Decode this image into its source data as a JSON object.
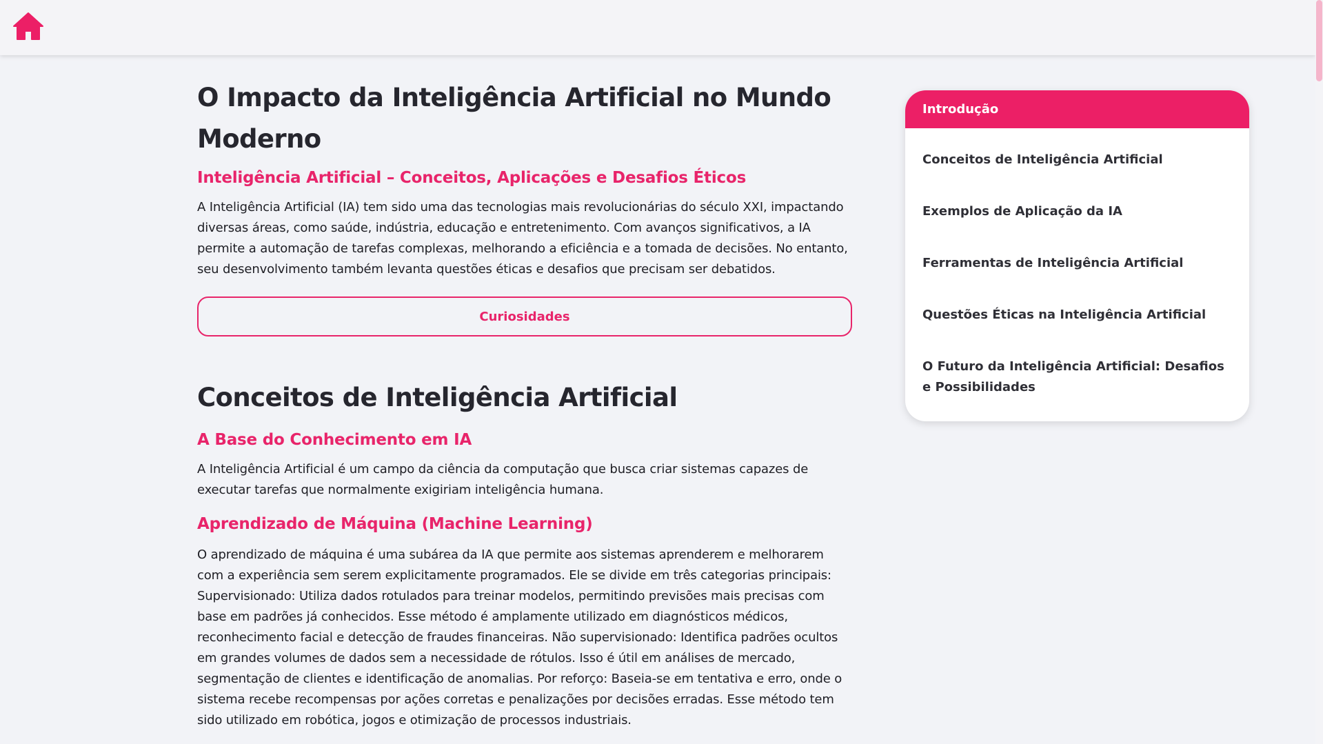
{
  "header": {
    "home_icon": "home-icon",
    "accent_color": "#ec1f66"
  },
  "article": {
    "title": "O Impacto da Inteligência Artificial no Mundo Moderno",
    "intro_subtitle": "Inteligência Artificial – Conceitos, Aplicações e Desafios Éticos",
    "intro_text": "A Inteligência Artificial (IA) tem sido uma das tecnologias mais revolucionárias do século XXI, impactando diversas áreas, como saúde, indústria, educação e entretenimento. Com avanços significativos, a IA permite a automação de tarefas complexas, melhorando a eficiência e a tomada de decisões. No entanto, seu desenvolvimento também levanta questões éticas e desafios que precisam ser debatidos.",
    "curiosities_button": "Curiosidades",
    "section1": {
      "title": "Conceitos de Inteligência Artificial",
      "sub1_title": "A Base do Conhecimento em IA",
      "sub1_text": "A Inteligência Artificial é um campo da ciência da computação que busca criar sistemas capazes de executar tarefas que normalmente exigiriam inteligência humana.",
      "sub2_title": "Aprendizado de Máquina (Machine Learning)",
      "sub2_text": "O aprendizado de máquina é uma subárea da IA que permite aos sistemas aprenderem e melhorarem com a experiência sem serem explicitamente programados. Ele se divide em três categorias principais: Supervisionado: Utiliza dados rotulados para treinar modelos, permitindo previsões mais precisas com base em padrões já conhecidos. Esse método é amplamente utilizado em diagnósticos médicos, reconhecimento facial e detecção de fraudes financeiras. Não supervisionado: Identifica padrões ocultos em grandes volumes de dados sem a necessidade de rótulos. Isso é útil em análises de mercado, segmentação de clientes e identificação de anomalias. Por reforço: Baseia-se em tentativa e erro, onde o sistema recebe recompensas por ações corretas e penalizações por decisões erradas. Esse método tem sido utilizado em robótica, jogos e otimização de processos industriais."
    }
  },
  "toc": {
    "active": "Introdução",
    "items": [
      "Conceitos de Inteligência Artificial",
      "Exemplos de Aplicação da IA",
      "Ferramentas de Inteligência Artificial",
      "Questões Éticas na Inteligência Artificial",
      "O Futuro da Inteligência Artificial: Desafios e Possibilidades"
    ]
  }
}
